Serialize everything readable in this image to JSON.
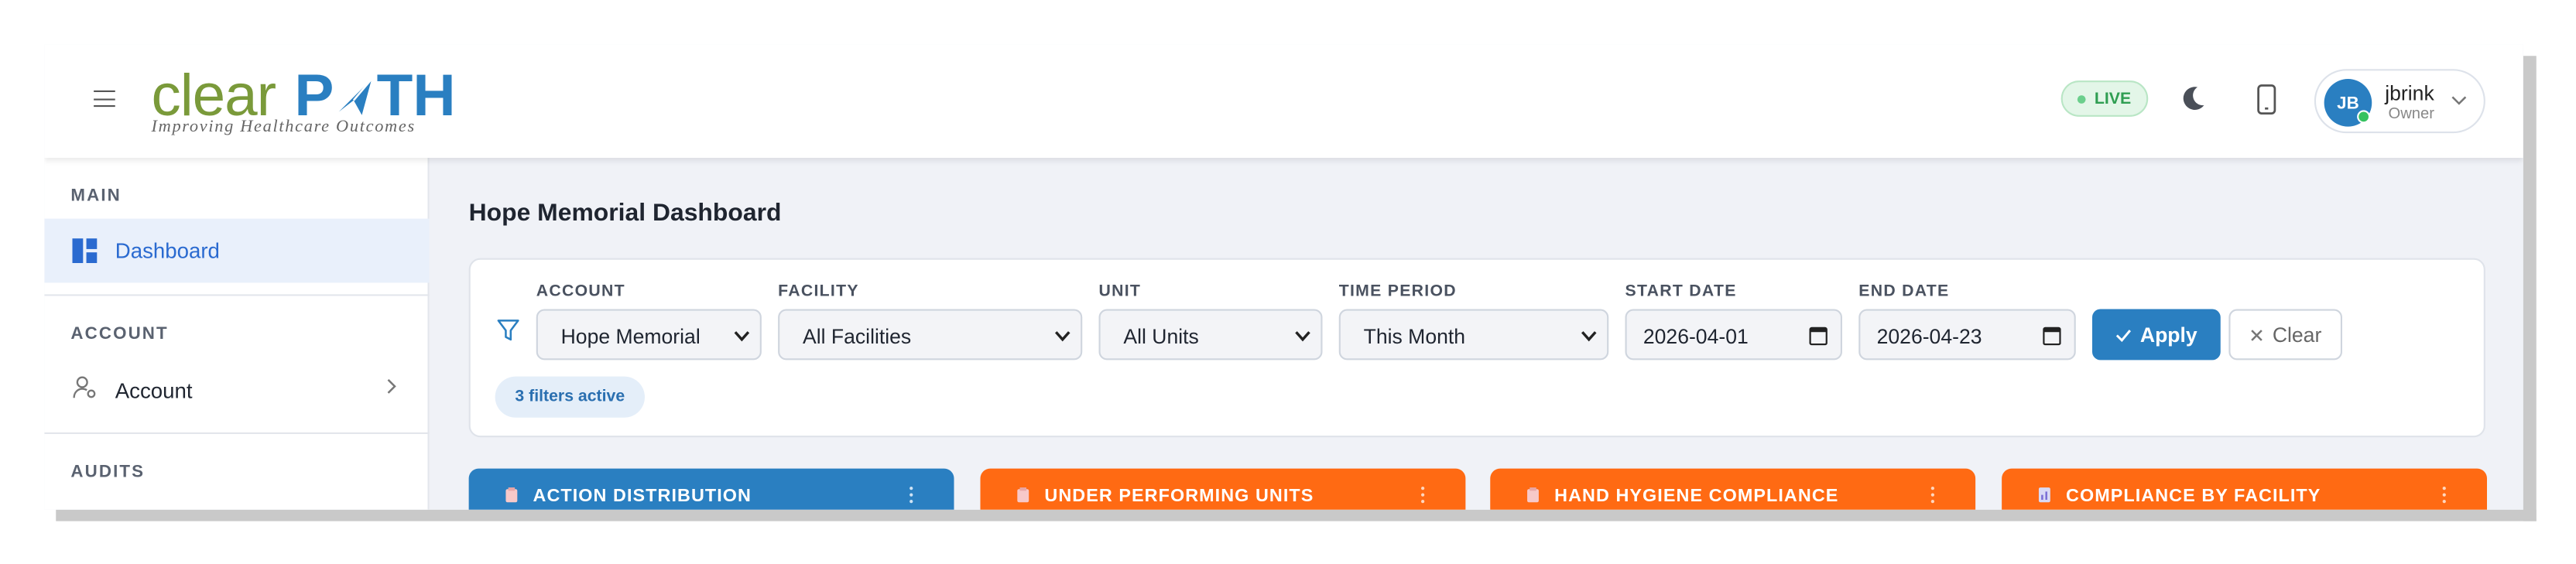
{
  "header": {
    "logo_word1": "clear",
    "logo_word2": "P",
    "logo_word3": "TH",
    "logo_tagline": "Improving Healthcare Outcomes",
    "live_label": "LIVE",
    "user": {
      "initials": "JB",
      "name": "jbrink",
      "role": "Owner"
    },
    "icons": [
      "hamburger-icon",
      "moon-icon",
      "mobile-icon",
      "chevron-down-icon"
    ]
  },
  "sidebar": {
    "sections": [
      {
        "label": "MAIN",
        "items": [
          {
            "label": "Dashboard",
            "icon": "dashboard-icon",
            "active": true
          }
        ]
      },
      {
        "label": "ACCOUNT",
        "items": [
          {
            "label": "Account",
            "icon": "user-settings-icon",
            "has_submenu": true
          }
        ]
      },
      {
        "label": "AUDITS",
        "items": []
      }
    ]
  },
  "main": {
    "page_title": "Hope Memorial Dashboard",
    "filters": {
      "account": {
        "label": "ACCOUNT",
        "value": "Hope Memorial"
      },
      "facility": {
        "label": "FACILITY",
        "value": "All Facilities"
      },
      "unit": {
        "label": "UNIT",
        "value": "All Units"
      },
      "time_period": {
        "label": "TIME PERIOD",
        "value": "This Month"
      },
      "start_date": {
        "label": "START DATE",
        "value": "2026-04-01"
      },
      "end_date": {
        "label": "END DATE",
        "value": "2026-04-23"
      },
      "apply_label": "Apply",
      "clear_label": "Clear",
      "active_count_label": "3 filters active"
    },
    "widgets": [
      {
        "title": "ACTION DISTRIBUTION",
        "color": "#2a7fc1"
      },
      {
        "title": "UNDER PERFORMING UNITS",
        "color": "#ff6a13"
      },
      {
        "title": "HAND HYGIENE COMPLIANCE",
        "color": "#ff6a13"
      },
      {
        "title": "COMPLIANCE BY FACILITY",
        "color": "#ff6a13"
      }
    ]
  },
  "colors": {
    "brand_blue": "#2a7fc1",
    "brand_green": "#7a9a3a",
    "widget_orange": "#ff6a13",
    "live_green": "#2f9e52"
  }
}
